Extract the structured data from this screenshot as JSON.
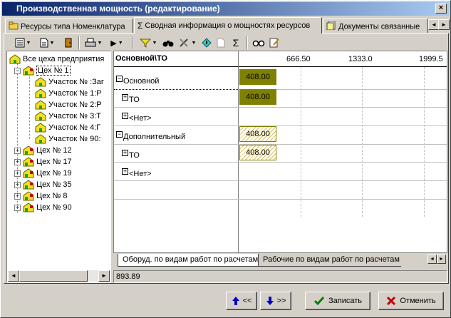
{
  "window": {
    "title": "Производственная мощность (редактирование)",
    "close_glyph": "×"
  },
  "tabs": [
    {
      "label": "Ресурсы типа Номенклатура",
      "icon": "folder-icon"
    },
    {
      "label": "Сводная информация о мощностях ресурсов",
      "icon": "sigma-icon",
      "glyph": "Σ"
    },
    {
      "label": "Документы связанные",
      "icon": "documents-icon"
    }
  ],
  "tab_scroll": {
    "left": "◄",
    "right": "►"
  },
  "toolbar": {
    "sigma_glyph": "Σ"
  },
  "tree": {
    "root": "Все цеха предприятия",
    "nodes": [
      {
        "label": "Цех № 1",
        "expanded": true
      },
      {
        "label": "Участок № :Заг"
      },
      {
        "label": "Участок № 1:Р"
      },
      {
        "label": "Участок № 2:Р"
      },
      {
        "label": "Участок № 3:Т"
      },
      {
        "label": "Участок № 4:Г"
      },
      {
        "label": "Участок № 90:"
      },
      {
        "label": "Цех № 12"
      },
      {
        "label": "Цех № 17"
      },
      {
        "label": "Цех № 19"
      },
      {
        "label": "Цех № 35"
      },
      {
        "label": "Цех № 8"
      },
      {
        "label": "Цех № 90"
      }
    ],
    "expanded_glyph": "−",
    "collapsed_glyph": "+"
  },
  "grid": {
    "header": "Основной\\ТО",
    "ticks": [
      "666.50",
      "1333.0",
      "1999.5"
    ],
    "rows": [
      {
        "label": "Основной",
        "value": "408.00",
        "style": "solid",
        "toggle": "−"
      },
      {
        "label": "ТО",
        "value": "408.00",
        "style": "solid",
        "toggle": "+"
      },
      {
        "label": "<Нет>",
        "value": "",
        "toggle": "+"
      },
      {
        "label": "Дополнительный",
        "value": "408.00",
        "style": "hatch",
        "toggle": "−"
      },
      {
        "label": "ТО",
        "value": "408.00",
        "style": "hatch",
        "toggle": "+"
      },
      {
        "label": "<Нет>",
        "value": "",
        "toggle": "+"
      }
    ]
  },
  "bottom_tabs": [
    "Оборуд. по видам работ по расчетам",
    "Рабочие по видам работ по расчетам"
  ],
  "status": {
    "value": "893.89"
  },
  "buttons": {
    "prev_label": "<<",
    "next_label": ">>",
    "save_label": "Записать",
    "cancel_label": "Отменить"
  },
  "colors": {
    "title_start": "#0a246a",
    "title_end": "#a6caf0",
    "bar_solid": "#808000",
    "save_check": "#008000",
    "cancel_x": "#c00000",
    "arrow_blue": "#0000c0"
  }
}
